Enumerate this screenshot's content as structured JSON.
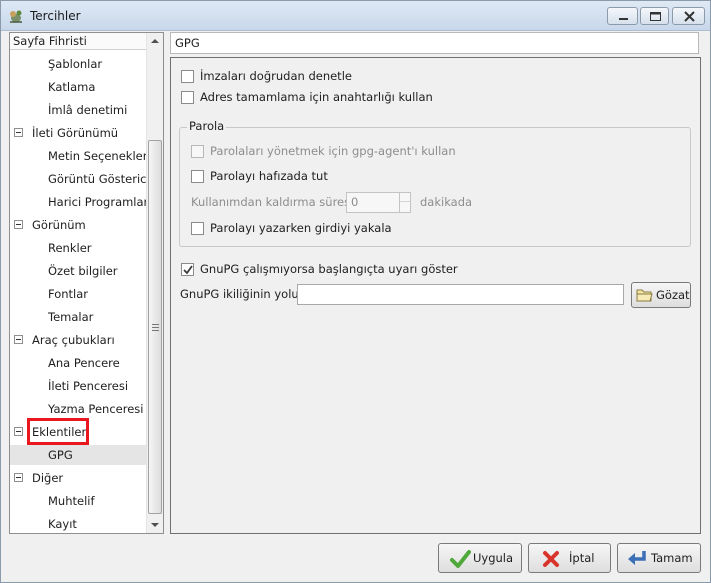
{
  "window": {
    "title": "Tercihler"
  },
  "sidebar": {
    "header": "Sayfa Fihristi",
    "items": [
      {
        "label": "Şablonlar",
        "level": 1
      },
      {
        "label": "Katlama",
        "level": 1
      },
      {
        "label": "İmlâ denetimi",
        "level": 1
      },
      {
        "label": "İleti Görünümü",
        "level": 0
      },
      {
        "label": "Metin Seçenekleri",
        "level": 1
      },
      {
        "label": "Görüntü Gösterici",
        "level": 1
      },
      {
        "label": "Harici Programlar",
        "level": 1
      },
      {
        "label": "Görünüm",
        "level": 0
      },
      {
        "label": "Renkler",
        "level": 1
      },
      {
        "label": "Özet bilgiler",
        "level": 1
      },
      {
        "label": "Fontlar",
        "level": 1
      },
      {
        "label": "Temalar",
        "level": 1
      },
      {
        "label": "Araç çubukları",
        "level": 0
      },
      {
        "label": "Ana Pencere",
        "level": 1
      },
      {
        "label": "İleti Penceresi",
        "level": 1
      },
      {
        "label": "Yazma Penceresi",
        "level": 1
      },
      {
        "label": "Eklentiler",
        "level": 0
      },
      {
        "label": "GPG",
        "level": 1,
        "selected": true
      },
      {
        "label": "Diğer",
        "level": 0
      },
      {
        "label": "Muhtelif",
        "level": 1
      },
      {
        "label": "Kayıt",
        "level": 1
      }
    ]
  },
  "panel": {
    "title": "GPG",
    "verify_sig_label": "İmzaları doğrudan denetle",
    "verify_sig_checked": false,
    "autocomplete_label": "Adres tamamlama için anahtarlığı kullan",
    "autocomplete_checked": false,
    "passphrase": {
      "group_title": "Parola",
      "gpg_agent_label": "Parolaları yönetmek için gpg-agent'ı kullan",
      "gpg_agent_checked": false,
      "store_label": "Parolayı hafızada tut",
      "store_checked": false,
      "expire_label": "Kullanımdan kaldırma süresi",
      "expire_value": "0",
      "expire_unit": "dakikada",
      "grab_label": "Parolayı yazarken girdiyi yakala",
      "grab_checked": false
    },
    "warn_label": "GnuPG çalışmıyorsa başlangıçta uyarı göster",
    "warn_checked": true,
    "path_label": "GnuPG ikiliğinin yolu",
    "path_value": "",
    "browse_label": "Gözat"
  },
  "buttons": {
    "apply": "Uygula",
    "cancel": "İptal",
    "ok": "Tamam"
  },
  "colors": {
    "highlight": "#e8181e",
    "titlebar": "#d3e0ef"
  }
}
